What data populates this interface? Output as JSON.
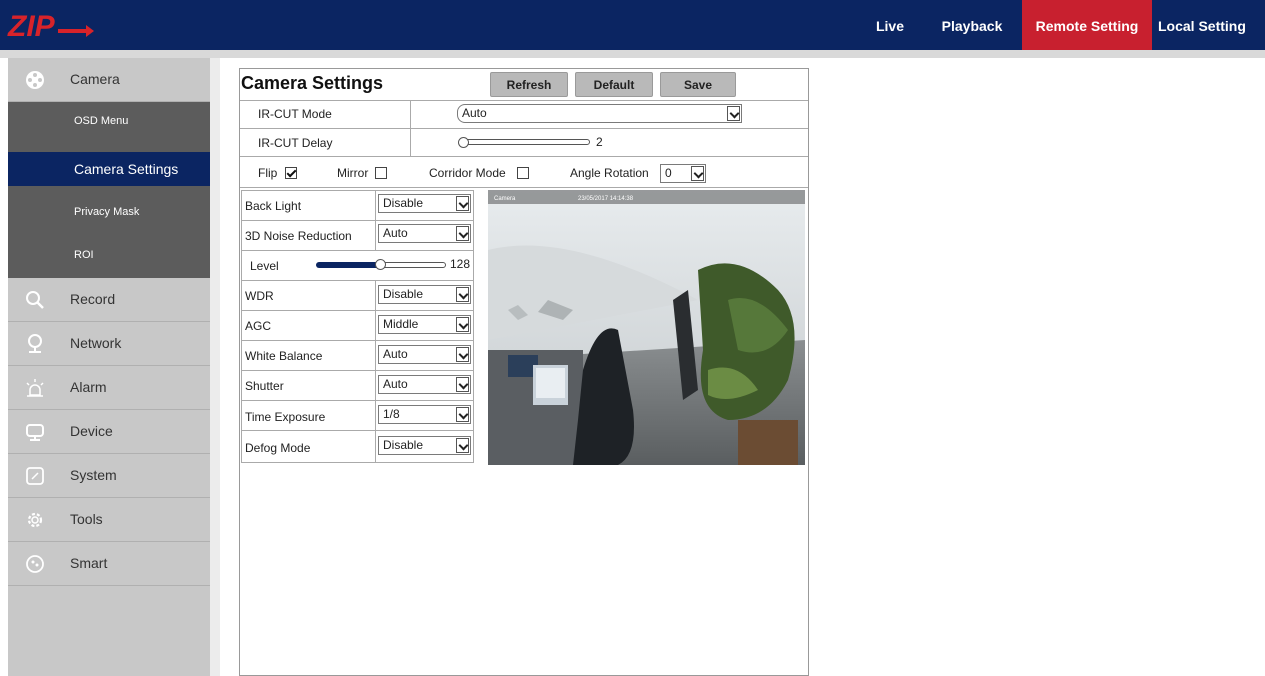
{
  "header": {
    "nav": [
      "Live",
      "Playback",
      "Remote Setting",
      "Local Setting"
    ],
    "active_nav": "Remote Setting",
    "brand_color": "#0b2562",
    "accent_color": "#c8202f"
  },
  "sidebar": {
    "items": [
      {
        "label": "Camera",
        "icon": "camera-icon"
      },
      {
        "label": "Record",
        "icon": "search-icon"
      },
      {
        "label": "Network",
        "icon": "location-pin-icon"
      },
      {
        "label": "Alarm",
        "icon": "alarm-light-icon"
      },
      {
        "label": "Device",
        "icon": "monitor-icon"
      },
      {
        "label": "System",
        "icon": "system-icon"
      },
      {
        "label": "Tools",
        "icon": "gear-icon"
      },
      {
        "label": "Smart",
        "icon": "smart-icon"
      }
    ],
    "sub_items": [
      "OSD Menu",
      "Camera Settings",
      "Privacy Mask",
      "ROI"
    ],
    "active_sub": "Camera Settings"
  },
  "main": {
    "title": "Camera Settings",
    "buttons": {
      "refresh": "Refresh",
      "default": "Default",
      "save": "Save"
    },
    "ircut_mode": {
      "label": "IR-CUT Mode",
      "value": "Auto"
    },
    "ircut_delay": {
      "label": "IR-CUT Delay",
      "value": "2",
      "fraction": 0.0
    },
    "flip": {
      "label": "Flip",
      "checked": true
    },
    "mirror": {
      "label": "Mirror",
      "checked": false
    },
    "corridor": {
      "label": "Corridor Mode",
      "checked": false
    },
    "angle_rotation": {
      "label": "Angle Rotation",
      "value": "0"
    },
    "settings": [
      {
        "label": "Back Light",
        "value": "Disable"
      },
      {
        "label": "3D Noise Reduction",
        "value": "Auto"
      },
      {
        "label": "WDR",
        "value": "Disable"
      },
      {
        "label": "AGC",
        "value": "Middle"
      },
      {
        "label": "White Balance",
        "value": "Auto"
      },
      {
        "label": "Shutter",
        "value": "Auto"
      },
      {
        "label": "Time Exposure",
        "value": "1/8"
      },
      {
        "label": "Defog Mode",
        "value": "Disable"
      }
    ],
    "level": {
      "label": "Level",
      "value": "128",
      "fraction": 0.5
    },
    "video": {
      "channel_label": "Camera",
      "timestamp": "23/05/2017 14:14:38"
    }
  }
}
